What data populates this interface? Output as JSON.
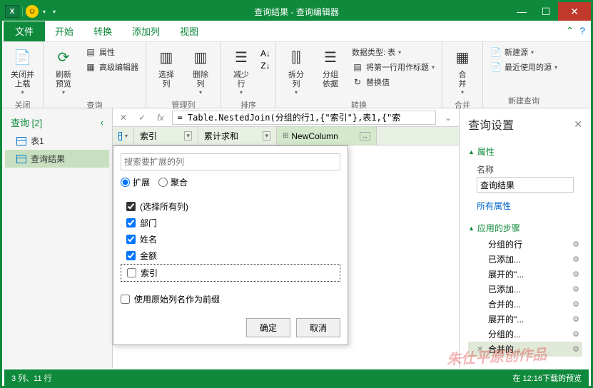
{
  "window": {
    "title": "查询结果 - 查询编辑器"
  },
  "tabs": {
    "file": "文件",
    "home": "开始",
    "transform": "转换",
    "addcol": "添加列",
    "view": "视图"
  },
  "ribbon": {
    "close_load": "关闭并\n上载",
    "close": "关闭",
    "refresh": "刷新\n预览",
    "props": "属性",
    "adveditor": "高级编辑器",
    "query": "查询",
    "selcol": "选择\n列",
    "delcol": "删除\n列",
    "managecol": "管理列",
    "reducerow": "减少\n行",
    "sort": "排序",
    "splitcol": "拆分\n列",
    "groupby": "分组\n依据",
    "datatype": "数据类型: 表",
    "firstrow": "将第一行用作标题",
    "replace": "替换值",
    "transform": "转换",
    "merge": "合\n并",
    "combine": "合并",
    "newsource": "新建源",
    "recentsource": "最近使用的源",
    "newquery": "新建查询"
  },
  "sidebar": {
    "title": "查询 [2]",
    "items": [
      "表1",
      "查询结果"
    ]
  },
  "formula": "= Table.NestedJoin(分组的行1,{\"索引\"},表1,{\"索",
  "columns": [
    "索引",
    "累计求和",
    "NewColumn"
  ],
  "popup": {
    "search_placeholder": "搜索要扩展的列",
    "expand": "扩展",
    "aggregate": "聚合",
    "selectall": "(选择所有列)",
    "cols": [
      "部门",
      "姓名",
      "金额",
      "索引"
    ],
    "prefix": "使用原始列名作为前缀",
    "ok": "确定",
    "cancel": "取消"
  },
  "settings": {
    "title": "查询设置",
    "props": "属性",
    "name_label": "名称",
    "name_value": "查询结果",
    "allprops": "所有属性",
    "steps_title": "应用的步骤",
    "steps": [
      "分组的行",
      "已添加...",
      "展开的\"...",
      "已添加...",
      "合并的...",
      "展开的\"...",
      "分组的...",
      "合并的..."
    ]
  },
  "status": {
    "left": "3 列、11 行",
    "right": "在 12:16下载的预览"
  },
  "watermark": "朱仕平原创作品"
}
